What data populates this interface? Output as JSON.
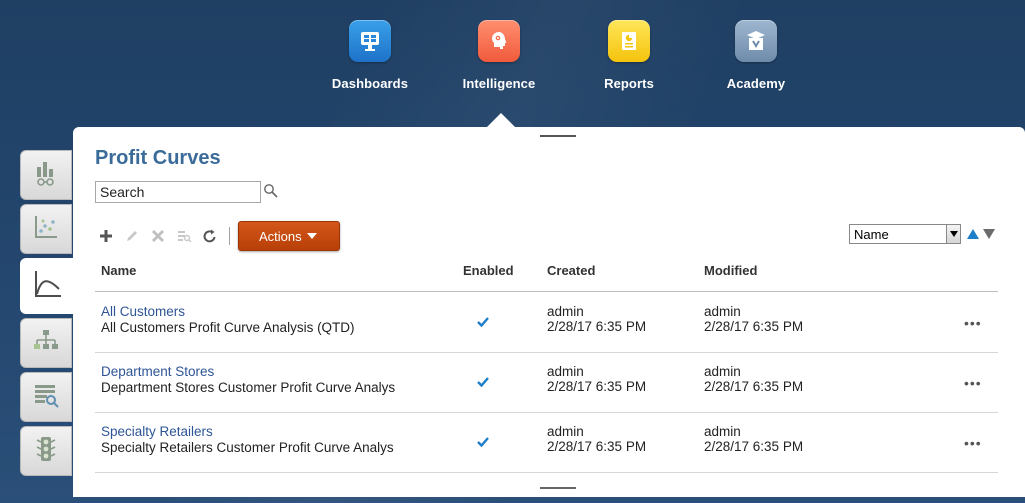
{
  "nav": {
    "items": [
      {
        "label": "Dashboards",
        "icon": "dashboards-icon",
        "color": "#2a87da"
      },
      {
        "label": "Intelligence",
        "icon": "intelligence-icon",
        "color": "#f4704f",
        "active": true
      },
      {
        "label": "Reports",
        "icon": "reports-icon",
        "color": "#f7d31d"
      },
      {
        "label": "Academy",
        "icon": "academy-icon",
        "color": "#829cb9"
      }
    ]
  },
  "sidebar": {
    "tabs": [
      {
        "icon": "bar-chart-glasses-icon"
      },
      {
        "icon": "scatter-plot-icon"
      },
      {
        "icon": "profit-curve-icon",
        "active": true
      },
      {
        "icon": "hierarchy-icon"
      },
      {
        "icon": "list-search-icon"
      },
      {
        "icon": "traffic-light-icon"
      }
    ]
  },
  "page": {
    "title": "Profit Curves",
    "search_placeholder": "Search"
  },
  "toolbar": {
    "actions_label": "Actions"
  },
  "sort": {
    "selected": "Name"
  },
  "table": {
    "headers": {
      "name": "Name",
      "enabled": "Enabled",
      "created": "Created",
      "modified": "Modified"
    },
    "rows": [
      {
        "name": "All Customers",
        "description": "All Customers Profit Curve Analysis (QTD)",
        "enabled": true,
        "created_by": "admin",
        "created_at": "2/28/17 6:35 PM",
        "modified_by": "admin",
        "modified_at": "2/28/17 6:35 PM"
      },
      {
        "name": "Department Stores",
        "description": "Department Stores Customer Profit Curve Analys",
        "enabled": true,
        "created_by": "admin",
        "created_at": "2/28/17 6:35 PM",
        "modified_by": "admin",
        "modified_at": "2/28/17 6:35 PM"
      },
      {
        "name": "Specialty Retailers",
        "description": "Specialty Retailers Customer Profit Curve Analys",
        "enabled": true,
        "created_by": "admin",
        "created_at": "2/28/17 6:35 PM",
        "modified_by": "admin",
        "modified_at": "2/28/17 6:35 PM"
      }
    ],
    "more_label": "•••"
  },
  "colors": {
    "accent": "#3a6b99",
    "link": "#2d5596",
    "actions_button": "#c84b0f",
    "check": "#1d7ec9"
  }
}
